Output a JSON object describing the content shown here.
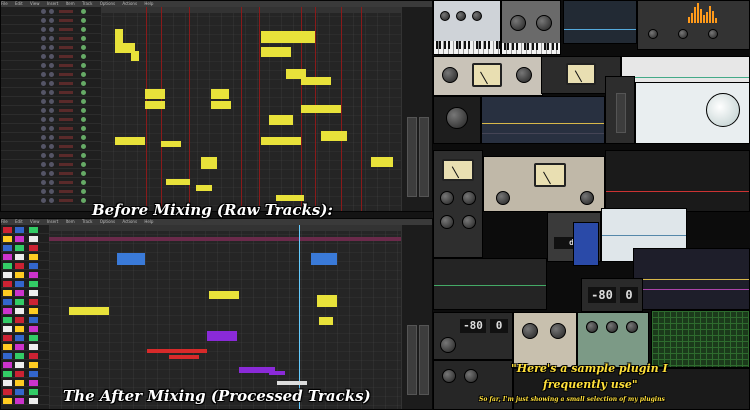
{
  "captions": {
    "before": "Before Mixing (Raw Tracks):",
    "after": "The After Mixing (Processed Tracks)",
    "sample_line1": "\"Here's a sample plugin I",
    "sample_line2": "frequently use\"",
    "sample_note": "So far, I'm just showing a small selection of my plugins"
  },
  "daw": {
    "menu": [
      "File",
      "Edit",
      "View",
      "Insert",
      "Item",
      "Track",
      "Options",
      "Actions",
      "Help"
    ]
  },
  "plugins": {
    "readout_a": "-80",
    "readout_b": "0",
    "readout_c": "-80",
    "readout_d": "0"
  },
  "colors": {
    "midi_yellow": "#e8e23a",
    "midi_blue": "#3a7ad8",
    "midi_red": "#d82a2a",
    "midi_purple": "#8a2ad8",
    "marker_red": "#8a1a1a",
    "track_panel": "#1f1f1f"
  }
}
